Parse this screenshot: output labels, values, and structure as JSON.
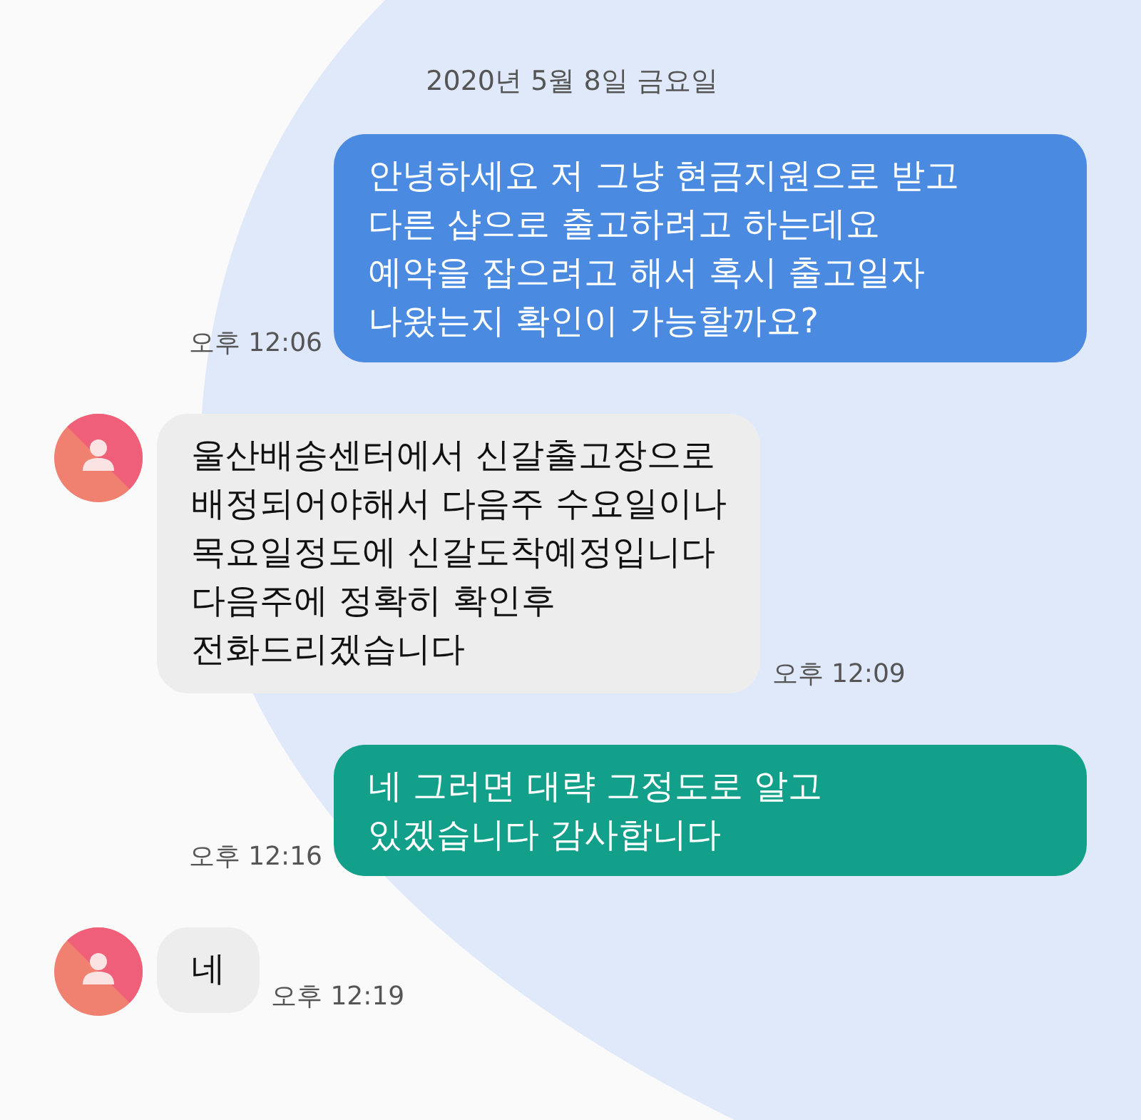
{
  "date": "2020년 5월 8일 금요일",
  "messages": [
    {
      "kind": "sent",
      "color": "#4a8ae0",
      "text": "안녕하세요 저 그냥 현금지원으로 받고\n다른 샵으로 출고하려고 하는데요\n예약을 잡으려고 해서 혹시 출고일자\n나왔는지 확인이 가능할까요?",
      "time": "오후 12:06"
    },
    {
      "kind": "received",
      "text": "울산배송센터에서 신갈출고장으로\n배정되어야해서 다음주 수요일이나\n목요일정도에 신갈도착예정입니다\n다음주에 정확히 확인후\n전화드리겠습니다",
      "time": "오후 12:09"
    },
    {
      "kind": "sent",
      "color": "#13a08a",
      "text": "네 그러면 대략 그정도로 알고\n있겠습니다 감사합니다",
      "time": "오후 12:16"
    },
    {
      "kind": "received",
      "text": "네",
      "time": "오후 12:19"
    }
  ]
}
